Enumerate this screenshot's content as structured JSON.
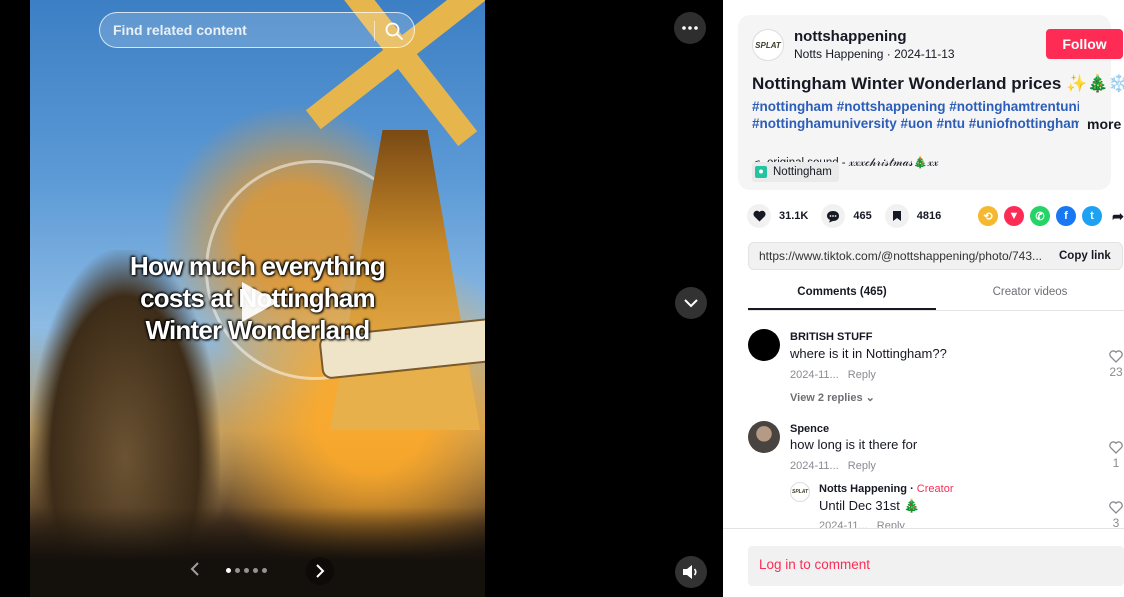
{
  "search": {
    "placeholder": "Find related content"
  },
  "media": {
    "overlay_lines": [
      "How much everything",
      "costs at Nottingham",
      "Winter Wonderland"
    ],
    "carousel": {
      "total_dots": 5,
      "active_index": 0
    }
  },
  "post": {
    "avatar_label": "SPLAT",
    "username": "nottshappening",
    "display_name": "Notts Happening",
    "date": "2024-11-13",
    "follow_label": "Follow",
    "title": "Nottingham Winter Wonderland prices ✨🎄❄️",
    "hashtags_line1": "#nottingham #nottshappening #nottinghamtrentuni",
    "hashtags_line2": "#nottinghamuniversity #uon #ntu #uniofnottingham...",
    "more_label": "more",
    "sound": "original sound - 𝓍𝓍𝓍𝒸𝒽𝓇𝒾𝓈𝓉𝓂𝒶𝓈🎄𝓍𝓍",
    "location": "Nottingham"
  },
  "stats": {
    "likes": "31.1K",
    "comments": "465",
    "saves": "4816"
  },
  "share_icons": [
    {
      "name": "repost-icon",
      "color": "#f5b82e",
      "glyph": "⟲"
    },
    {
      "name": "send-icon",
      "color": "#fe2c55",
      "glyph": "▼"
    },
    {
      "name": "whatsapp-icon",
      "color": "#25d366",
      "glyph": "✆"
    },
    {
      "name": "facebook-icon",
      "color": "#1877f2",
      "glyph": "f"
    },
    {
      "name": "twitter-icon",
      "color": "#1da1f2",
      "glyph": "t"
    }
  ],
  "link": {
    "url": "https://www.tiktok.com/@nottshappening/photo/743...",
    "copy_label": "Copy link"
  },
  "tabs": [
    {
      "label": "Comments (465)",
      "active": true
    },
    {
      "label": "Creator videos",
      "active": false
    }
  ],
  "comments": [
    {
      "user": "BRITISH STUFF",
      "text": "where is it in Nottingham??",
      "date": "2024-11...",
      "reply": "Reply",
      "likes": "23",
      "view_replies": "View 2 replies"
    },
    {
      "user": "Spence",
      "text": "how long is it there for",
      "date": "2024-11...",
      "reply": "Reply",
      "likes": "1"
    },
    {
      "user": "Notts Happening",
      "creator_tag": "Creator",
      "text": "Until Dec 31st 🎄",
      "date": "2024-11...",
      "reply": "Reply",
      "likes": "3"
    }
  ],
  "login": {
    "label": "Log in to comment"
  },
  "colors": {
    "accent": "#fe2c55",
    "hashtag": "#2b5db9"
  }
}
